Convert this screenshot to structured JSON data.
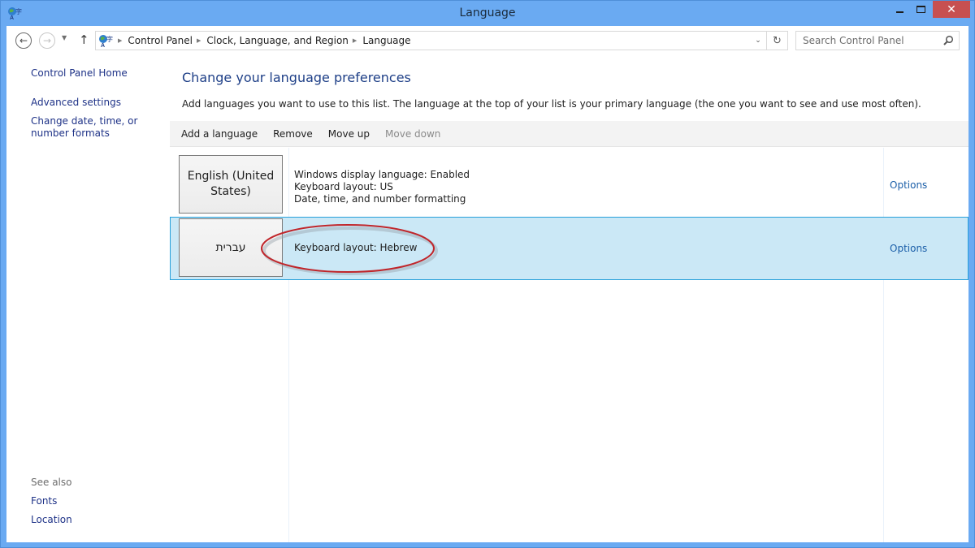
{
  "window": {
    "title": "Language",
    "close_glyph": "✕"
  },
  "navbar": {
    "back_glyph": "←",
    "forward_glyph": "→",
    "recent_glyph": "▼",
    "up_glyph": "↑",
    "breadcrumbs": [
      "Control Panel",
      "Clock, Language, and Region",
      "Language"
    ],
    "separator_glyph": "▶",
    "dropdown_glyph": "⌄",
    "refresh_glyph": "↻",
    "search": {
      "placeholder": "Search Control Panel",
      "value": ""
    }
  },
  "sidebar": {
    "links": [
      {
        "label": "Control Panel Home"
      },
      {
        "label": "Advanced settings"
      },
      {
        "label": "Change date, time, or number formats"
      }
    ],
    "see_also_label": "See also",
    "see_also": [
      {
        "label": "Fonts"
      },
      {
        "label": "Location"
      }
    ]
  },
  "main": {
    "heading": "Change your language preferences",
    "description": "Add languages you want to use to this list. The language at the top of your list is your primary language (the one you want to see and use most often).",
    "toolbar": {
      "add": "Add a language",
      "remove": "Remove",
      "move_up": "Move up",
      "move_down": "Move down",
      "move_down_enabled": false
    },
    "languages": [
      {
        "name": "English (United States)",
        "details": [
          "Windows display language: Enabled",
          "Keyboard layout: US",
          "Date, time, and number formatting"
        ],
        "options_label": "Options",
        "selected": false
      },
      {
        "name": "עברית",
        "details": [
          "Keyboard layout: Hebrew"
        ],
        "options_label": "Options",
        "selected": true
      }
    ],
    "annotation": {
      "shape": "ellipse",
      "color": "#c0262b",
      "target": "Keyboard layout: Hebrew"
    },
    "colors": {
      "selection_bg": "#cbe8f6",
      "selection_border": "#26a0da",
      "link": "#1a5ea8",
      "heading": "#1e3f87",
      "titlebar": "#6aaaf2",
      "close_button": "#c75050"
    }
  }
}
